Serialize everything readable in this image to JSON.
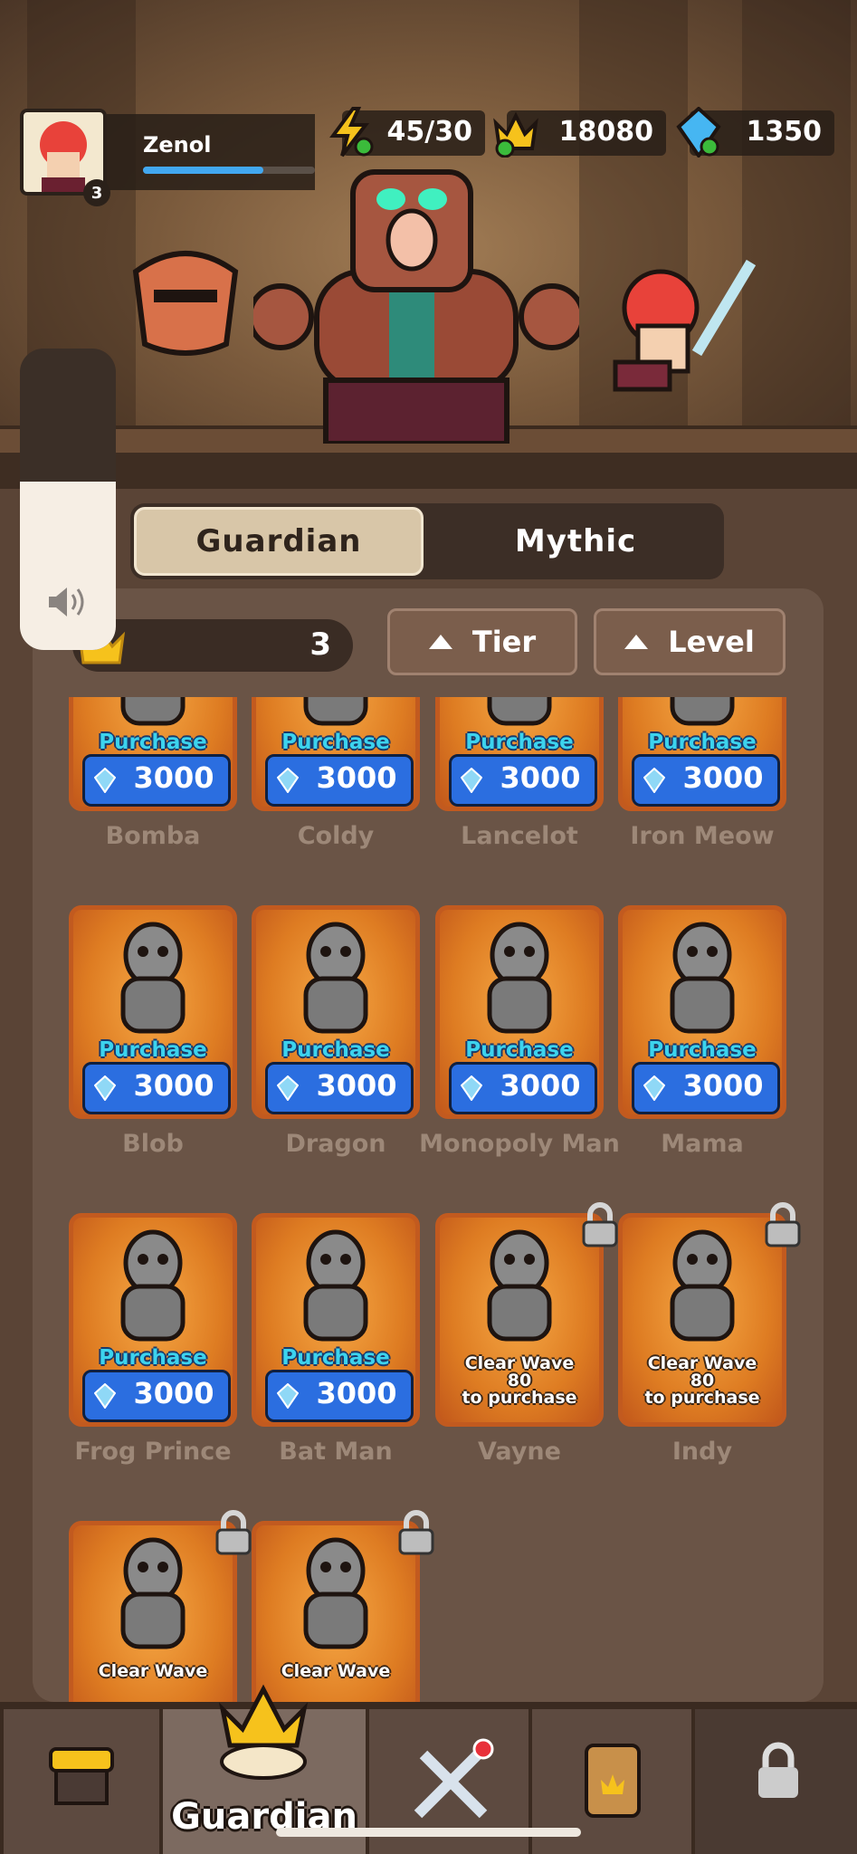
{
  "player": {
    "name": "Zenol",
    "level": "3",
    "xp_fraction": 0.7
  },
  "resources": {
    "energy": "45/30",
    "gold": "18080",
    "gems": "1350"
  },
  "tabs": [
    {
      "label": "Guardian",
      "active": true
    },
    {
      "label": "Mythic",
      "active": false
    }
  ],
  "owned_count": "3",
  "sort": {
    "tier_label": "Tier",
    "level_label": "Level"
  },
  "colors": {
    "accent_blue": "#2b6ee0",
    "purchase_cyan": "#3cd3ee",
    "card_orange": "#de7c22"
  },
  "guardians": [
    [
      {
        "name": "Bomba",
        "state": "purchase",
        "action": "Purchase",
        "price": "3000"
      },
      {
        "name": "Coldy",
        "state": "purchase",
        "action": "Purchase",
        "price": "3000"
      },
      {
        "name": "Lancelot",
        "state": "purchase",
        "action": "Purchase",
        "price": "3000"
      },
      {
        "name": "Iron Meow",
        "state": "purchase",
        "action": "Purchase",
        "price": "3000"
      }
    ],
    [
      {
        "name": "Blob",
        "state": "purchase",
        "action": "Purchase",
        "price": "3000"
      },
      {
        "name": "Dragon",
        "state": "purchase",
        "action": "Purchase",
        "price": "3000"
      },
      {
        "name": "Monopoly Man",
        "state": "purchase",
        "action": "Purchase",
        "price": "3000"
      },
      {
        "name": "Mama",
        "state": "purchase",
        "action": "Purchase",
        "price": "3000"
      }
    ],
    [
      {
        "name": "Frog Prince",
        "state": "purchase",
        "action": "Purchase",
        "price": "3000"
      },
      {
        "name": "Bat Man",
        "state": "purchase",
        "action": "Purchase",
        "price": "3000"
      },
      {
        "name": "Vayne",
        "state": "locked",
        "line1": "Clear Wave",
        "line2": "80",
        "line3": "to purchase"
      },
      {
        "name": "Indy",
        "state": "locked",
        "line1": "Clear Wave",
        "line2": "80",
        "line3": "to purchase"
      }
    ],
    [
      {
        "name": "",
        "state": "locked",
        "line1": "Clear Wave",
        "line2": "",
        "line3": ""
      },
      {
        "name": "",
        "state": "locked",
        "line1": "Clear Wave",
        "line2": "",
        "line3": ""
      }
    ]
  ],
  "nav": {
    "active_label": "Guardian"
  }
}
